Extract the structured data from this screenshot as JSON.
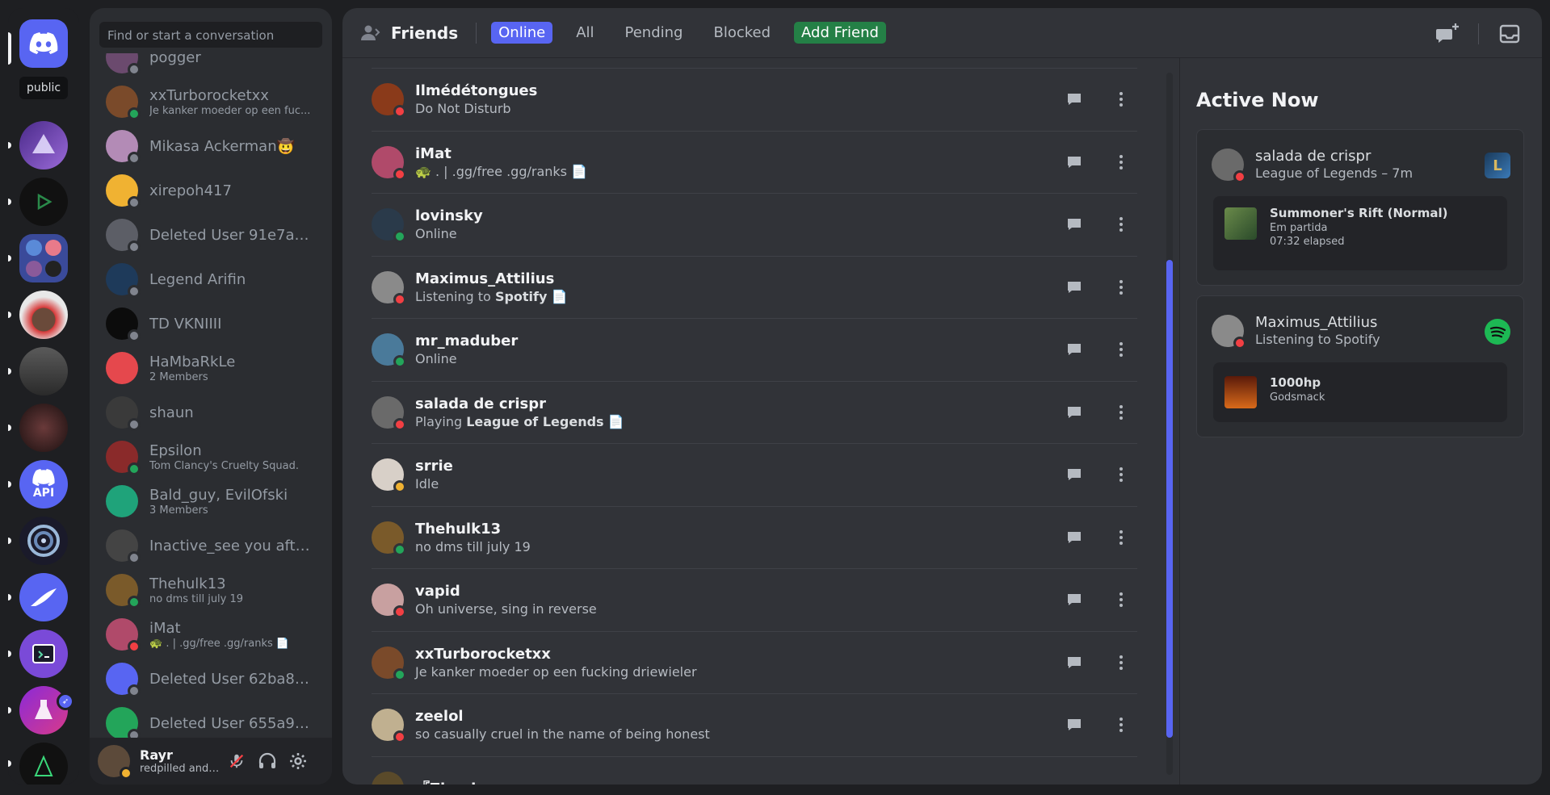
{
  "rail": {
    "public_label": "public",
    "servers": [
      {
        "name": "home",
        "icon": "discord-icon"
      },
      {
        "name": "server-blue-wave"
      },
      {
        "name": "server-triangle"
      },
      {
        "name": "server-folder"
      },
      {
        "name": "server-santa"
      },
      {
        "name": "server-suit"
      },
      {
        "name": "server-face"
      },
      {
        "name": "server-api",
        "label": "API"
      },
      {
        "name": "server-swirl"
      },
      {
        "name": "server-wing"
      },
      {
        "name": "server-bot"
      },
      {
        "name": "server-flask"
      },
      {
        "name": "server-tree"
      }
    ]
  },
  "dm": {
    "search_placeholder": "Find or start a conversation",
    "items": [
      {
        "name": "pogger",
        "status": "off",
        "color": "#6b4a6e"
      },
      {
        "name": "xxTurborocketxx",
        "sub": "Je kanker moeder op een fuc...",
        "status": "on",
        "color": "#7a4a2a"
      },
      {
        "name": "Mikasa Ackerman🤠",
        "status": "off",
        "color": "#b38bb6"
      },
      {
        "name": "xirepoh417",
        "status": "off",
        "color": "#f0b232"
      },
      {
        "name": "Deleted User 91e7ad...",
        "status": "off",
        "color": "#5c5e66"
      },
      {
        "name": "Legend Arifin",
        "status": "off",
        "color": "#1e3a5a"
      },
      {
        "name": "TD VKNIIII",
        "status": "off",
        "color": "#0c0c0c"
      },
      {
        "name": "HaMbaRkLe",
        "sub": "2 Members",
        "status": "",
        "color": "#e5484d"
      },
      {
        "name": "shaun",
        "status": "off",
        "color": "#3a3a3a"
      },
      {
        "name": "Epsilon",
        "sub": "Tom Clancy's Cruelty Squad.",
        "status": "on",
        "color": "#8a2a2a"
      },
      {
        "name": "Bald_guy, EvilOfski",
        "sub": "3 Members",
        "status": "",
        "color": "#1fa37a"
      },
      {
        "name": "Inactive_see you afte...",
        "status": "off",
        "color": "#444"
      },
      {
        "name": "Thehulk13",
        "sub": "no dms till july 19",
        "status": "on",
        "color": "#7a5a2a"
      },
      {
        "name": "iMat",
        "sub": "🐢 . | .gg/free .gg/ranks 📄",
        "status": "dnd",
        "color": "#b04a6a"
      },
      {
        "name": "Deleted User 62ba87...",
        "status": "off",
        "color": "#5865f2"
      },
      {
        "name": "Deleted User 655a9a...",
        "status": "off",
        "color": "#23a55a"
      }
    ]
  },
  "user": {
    "name": "Rayr",
    "status": "redpilled and ..."
  },
  "topbar": {
    "title": "Friends",
    "tabs": [
      {
        "label": "Online",
        "style": "active"
      },
      {
        "label": "All",
        "style": ""
      },
      {
        "label": "Pending",
        "style": ""
      },
      {
        "label": "Blocked",
        "style": ""
      },
      {
        "label": "Add Friend",
        "style": "add"
      }
    ]
  },
  "friends": [
    {
      "name": "Ilmédétongues",
      "status_text": "Do Not Disturb",
      "status": "dnd",
      "color": "#8a3a1a"
    },
    {
      "name": "iMat",
      "status_text": "🐢 . | .gg/free .gg/ranks 📄",
      "status": "dnd",
      "color": "#b04a6a"
    },
    {
      "name": "lovinsky",
      "status_text": "Online",
      "status": "on",
      "color": "#2a3a4a"
    },
    {
      "name": "Maximus_Attilius",
      "status_text": "Listening to ",
      "bold": "Spotify",
      "tail": " 📄",
      "status": "dnd",
      "color": "#8a8a8a"
    },
    {
      "name": "mr_maduber",
      "status_text": "Online",
      "status": "on",
      "color": "#4a7a9a"
    },
    {
      "name": "salada de crispr",
      "status_text": "Playing ",
      "bold": "League of Legends",
      "tail": " 📄",
      "status": "dnd",
      "color": "#6a6a6a"
    },
    {
      "name": "srrie",
      "status_text": "Idle",
      "status": "idle",
      "color": "#d8d0c8"
    },
    {
      "name": "Thehulk13",
      "status_text": "no dms till july 19",
      "status": "on",
      "color": "#7a5a2a"
    },
    {
      "name": "vapid",
      "status_text": "Oh universe, sing in reverse",
      "status": "dnd",
      "color": "#c8a0a0"
    },
    {
      "name": "xxTurborocketxx",
      "status_text": "Je kanker moeder op een fucking driewieler",
      "status": "on",
      "color": "#7a4a2a"
    },
    {
      "name": "zeelol",
      "status_text": "so casually cruel in the name of being honest",
      "status": "dnd",
      "color": "#c0b090"
    },
    {
      "name": "『Zhopir",
      "status_text": "",
      "status": "",
      "color": "#5a4a2a"
    }
  ],
  "active_now": {
    "title": "Active Now",
    "cards": [
      {
        "name": "salada de crispr",
        "sub": "League of Legends – 7m",
        "status": "dnd",
        "color": "#6a6a6a",
        "detail": {
          "line1": "Summoner's Rift (Normal)",
          "line2": "Em partida",
          "line3": "07:32 elapsed"
        }
      },
      {
        "name": "Maximus_Attilius",
        "sub": "Listening to Spotify",
        "status": "dnd",
        "color": "#8a8a8a",
        "detail": {
          "line1": "1000hp",
          "line2": "Godsmack"
        }
      }
    ]
  },
  "colors": {
    "accent": "#5865f2",
    "online": "#23a55a",
    "dnd": "#f23f43",
    "idle": "#f0b232",
    "add_friend": "#248046",
    "spotify": "#1db954"
  }
}
